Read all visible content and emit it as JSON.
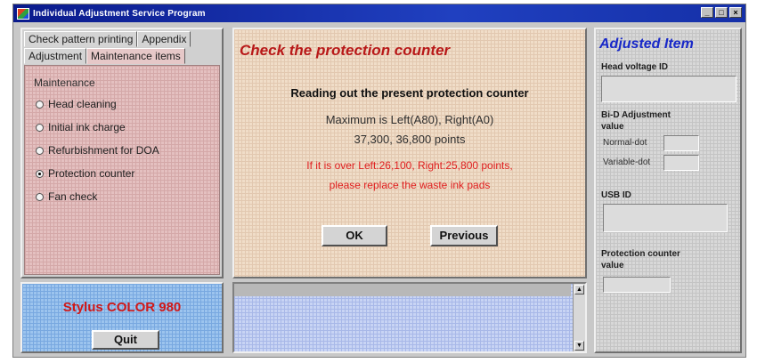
{
  "window": {
    "title": "Individual Adjustment Service Program",
    "buttons": [
      "_",
      "□",
      "×"
    ]
  },
  "tabs": {
    "row_back": [
      "Check pattern printing",
      "Appendix"
    ],
    "row_front": [
      "Adjustment",
      "Maintenance items"
    ],
    "active": "Maintenance items"
  },
  "maintenance": {
    "group_label": "Maintenance",
    "options": [
      {
        "label": "Head cleaning",
        "checked": false
      },
      {
        "label": "Initial ink charge",
        "checked": false
      },
      {
        "label": "Refurbishment for DOA",
        "checked": false
      },
      {
        "label": "Protection counter",
        "checked": true
      },
      {
        "label": "Fan check",
        "checked": false
      }
    ]
  },
  "model": {
    "name": "Stylus COLOR 980",
    "quit_label": "Quit"
  },
  "center": {
    "title": "Check the protection counter",
    "heading": "Reading out the present protection counter",
    "max_line": "Maximum is Left(A80), Right(A0)",
    "points_line": "37,300, 36,800 points",
    "warning_line1": "If it is over Left:26,100, Right:25,800 points,",
    "warning_line2": "please replace the waste ink pads",
    "ok_label": "OK",
    "previous_label": "Previous"
  },
  "log": {
    "scroll_up": "▲",
    "scroll_down": "▼"
  },
  "adjusted": {
    "title": "Adjusted Item",
    "head_voltage_label": "Head voltage ID",
    "head_voltage_value": "",
    "bid_label_1": "Bi-D Adjustment",
    "bid_label_2": "value",
    "normal_dot_label": "Normal-dot",
    "normal_dot_value": "",
    "variable_dot_label": "Variable-dot",
    "variable_dot_value": "",
    "usb_label": "USB ID",
    "usb_value": "",
    "protection_label_1": "Protection counter",
    "protection_label_2": "value",
    "protection_value": ""
  },
  "colors": {
    "accent_red": "#b81818",
    "title_blue": "#1828c8",
    "titlebar": "#0a1a8c"
  }
}
